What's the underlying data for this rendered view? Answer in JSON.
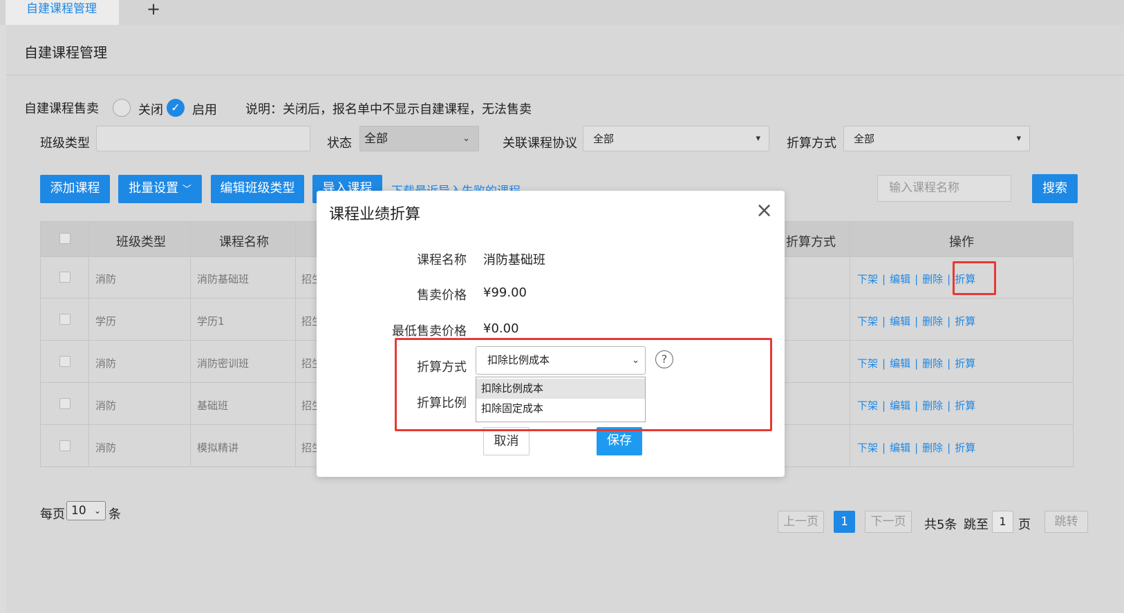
{
  "tabs": {
    "active": "自建课程管理",
    "add": "+"
  },
  "page_title": "自建课程管理",
  "sale_toggle": {
    "label": "自建课程售卖",
    "off_label": "关闭",
    "on_label": "启用",
    "selected": "启用",
    "note": "说明：关闭后，报名单中不显示自建课程，无法售卖"
  },
  "filters": {
    "class_type_label": "班级类型",
    "class_type_value": "",
    "status_label": "状态",
    "status_value": "全部",
    "protocol_label": "关联课程协议",
    "protocol_value": "全部",
    "method_label": "折算方式",
    "method_value": "全部"
  },
  "toolbar": {
    "add": "添加课程",
    "batch": "批量设置",
    "edit_types": "编辑班级类型",
    "import": "导入课程",
    "download_failed": "下载最近导入失败的课程",
    "search_placeholder": "输入课程名称",
    "search": "搜索"
  },
  "table": {
    "headers": {
      "class_type": "班级类型",
      "course_name": "课程名称",
      "method": "折算方式",
      "ops": "操作"
    },
    "rows": [
      {
        "class_type": "消防",
        "course_name": "消防基础班",
        "col3": "招生"
      },
      {
        "class_type": "学历",
        "course_name": "学历1",
        "col3": "招生"
      },
      {
        "class_type": "消防",
        "course_name": "消防密训班",
        "col3": "招生"
      },
      {
        "class_type": "消防",
        "course_name": "基础班",
        "col3": "招生"
      },
      {
        "class_type": "消防",
        "course_name": "模拟精讲",
        "col3": "招生"
      }
    ],
    "ops": {
      "off_shelf": "下架",
      "edit": "编辑",
      "delete": "删除",
      "convert": "折算"
    }
  },
  "pagination": {
    "per_page_label": "每页",
    "per_page_value": "10",
    "per_page_unit": "条",
    "prev": "上一页",
    "current": "1",
    "next": "下一页",
    "total": "共5条",
    "jump_label": "跳至",
    "jump_value": "1",
    "page_unit": "页",
    "jump_button": "跳转"
  },
  "modal": {
    "title": "课程业绩折算",
    "close": "×",
    "course_name_label": "课程名称",
    "course_name": "消防基础班",
    "price_label": "售卖价格",
    "price": "¥99.00",
    "min_price_label": "最低售卖价格",
    "min_price": "¥0.00",
    "method_label": "折算方式",
    "method_value": "扣除比例成本",
    "ratio_label": "折算比例",
    "help": "?",
    "options": [
      "扣除比例成本",
      "扣除固定成本"
    ],
    "cancel": "取消",
    "save": "保存"
  },
  "colors": {
    "accent": "#1e88e5",
    "highlight": "#e53935",
    "overlay": "#d8d8d8"
  }
}
